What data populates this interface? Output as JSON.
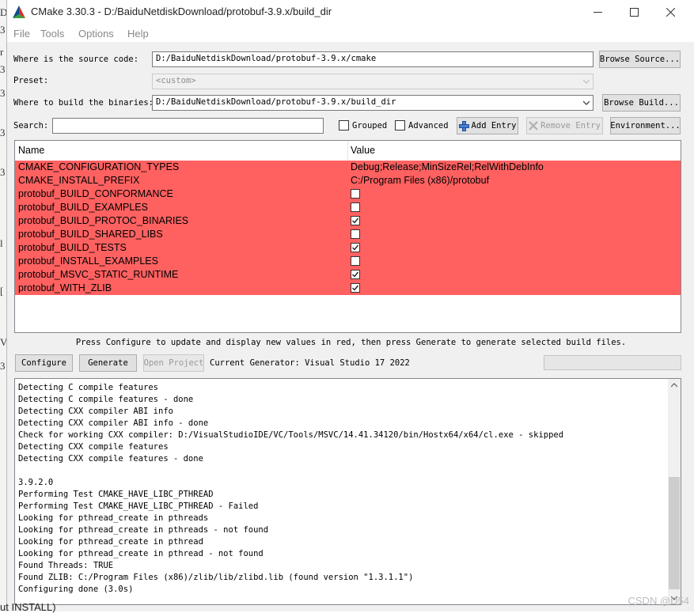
{
  "window": {
    "title": "CMake 3.30.3 - D:/BaiduNetdiskDownload/protobuf-3.9.x/build_dir",
    "minimize_icon": "minimize-icon",
    "maximize_icon": "maximize-icon",
    "close_icon": "close-icon"
  },
  "menu": {
    "file": "File",
    "tools": "Tools",
    "options": "Options",
    "help": "Help"
  },
  "source": {
    "label": "Where is the source code:",
    "value": "D:/BaiduNetdiskDownload/protobuf-3.9.x/cmake",
    "browse_label": "Browse Source..."
  },
  "preset": {
    "label": "Preset:",
    "value": "<custom>"
  },
  "build": {
    "label": "Where to build the binaries:",
    "value": "D:/BaiduNetdiskDownload/protobuf-3.9.x/build_dir",
    "browse_label": "Browse Build..."
  },
  "search": {
    "label": "Search:",
    "value": "",
    "grouped_label": "Grouped",
    "grouped_checked": false,
    "advanced_label": "Advanced",
    "advanced_checked": false,
    "add_entry_label": "Add Entry",
    "remove_entry_label": "Remove Entry",
    "environment_label": "Environment..."
  },
  "table": {
    "headers": {
      "name": "Name",
      "value": "Value"
    },
    "row_color": "#ff6161",
    "rows": [
      {
        "name": "CMAKE_CONFIGURATION_TYPES",
        "value": "Debug;Release;MinSizeRel;RelWithDebInfo"
      },
      {
        "name": "CMAKE_INSTALL_PREFIX",
        "value": "C:/Program Files (x86)/protobuf"
      },
      {
        "name": "protobuf_BUILD_CONFORMANCE",
        "checked": false
      },
      {
        "name": "protobuf_BUILD_EXAMPLES",
        "checked": false
      },
      {
        "name": "protobuf_BUILD_PROTOC_BINARIES",
        "checked": true
      },
      {
        "name": "protobuf_BUILD_SHARED_LIBS",
        "checked": false
      },
      {
        "name": "protobuf_BUILD_TESTS",
        "checked": true
      },
      {
        "name": "protobuf_INSTALL_EXAMPLES",
        "checked": false
      },
      {
        "name": "protobuf_MSVC_STATIC_RUNTIME",
        "checked": true
      },
      {
        "name": "protobuf_WITH_ZLIB",
        "checked": true
      }
    ]
  },
  "hint": "Press Configure to update and display new values in red, then press Generate to generate selected build files.",
  "actions": {
    "configure_label": "Configure",
    "generate_label": "Generate",
    "open_project_label": "Open Project",
    "generator_text": "Current Generator: Visual Studio 17 2022"
  },
  "output": {
    "lines": [
      "Detecting C compile features",
      "Detecting C compile features - done",
      "Detecting CXX compiler ABI info",
      "Detecting CXX compiler ABI info - done",
      "Check for working CXX compiler: D:/VisualStudioIDE/VC/Tools/MSVC/14.41.34120/bin/Hostx64/x64/cl.exe - skipped",
      "Detecting CXX compile features",
      "Detecting CXX compile features - done",
      "",
      "3.9.2.0",
      "Performing Test CMAKE_HAVE_LIBC_PTHREAD",
      "Performing Test CMAKE_HAVE_LIBC_PTHREAD - Failed",
      "Looking for pthread_create in pthreads",
      "Looking for pthread_create in pthreads - not found",
      "Looking for pthread_create in pthread",
      "Looking for pthread_create in pthread - not found",
      "Found Threads: TRUE",
      "Found ZLIB: C:/Program Files (x86)/zlib/lib/zlibd.lib (found version \"1.3.1.1\")",
      "Configuring done (3.0s)"
    ]
  },
  "watermark": "CSDN @D54",
  "background_text": "ut INSTALL)"
}
